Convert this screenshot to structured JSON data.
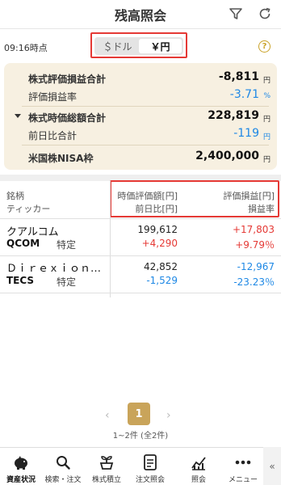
{
  "header": {
    "title": "残高照会"
  },
  "toolbar": {
    "time": "09:16時点"
  },
  "currency_toggle": {
    "dollar_label": "＄ドル",
    "yen_label": "￥円",
    "selected": "yen"
  },
  "summary": {
    "unrealized_total": {
      "label": "株式評価損益合計",
      "value": "-8,811",
      "unit": "円"
    },
    "unrealized_rate": {
      "label": "評価損益率",
      "value": "-3.71",
      "unit": "%"
    },
    "market_value_total": {
      "label": "株式時価総額合計",
      "value": "228,819",
      "unit": "円"
    },
    "day_change_total": {
      "label": "前日比合計",
      "value": "-119",
      "unit": "円"
    },
    "nisa_quota": {
      "label": "米国株NISA枠",
      "value": "2,400,000",
      "unit": "円"
    }
  },
  "table": {
    "header_left": [
      "銘柄",
      "ティッカー"
    ],
    "header_mid": [
      "時価評価額[円]",
      "前日比[円]"
    ],
    "header_right": [
      "評価損益[円]",
      "損益率"
    ],
    "rows": [
      {
        "name": "クアルコム",
        "ticker": "QCOM",
        "account": "特定",
        "market_value": "199,612",
        "day_change": "+4,290",
        "pl": "+17,803",
        "pl_rate": "+9.79％"
      },
      {
        "name": "Ｄｉｒｅｘｉｏｎ…",
        "ticker": "TECS",
        "account": "特定",
        "market_value": "42,852",
        "day_change": "-1,529",
        "pl": "-12,967",
        "pl_rate": "-23.23％"
      }
    ]
  },
  "pagination": {
    "current": "1",
    "count_text": "1~2件 (全2件)"
  },
  "tabbar": {
    "items": [
      {
        "label": "資産状況",
        "icon": "piggy-bank-icon"
      },
      {
        "label": "検索・注文",
        "icon": "search-icon"
      },
      {
        "label": "株式積立",
        "icon": "seedling-icon"
      },
      {
        "label": "注文照会",
        "icon": "order-list-icon"
      },
      {
        "label": "照会",
        "icon": "chart-icon"
      },
      {
        "label": "メニュー",
        "icon": "more-icon"
      }
    ]
  },
  "colors": {
    "accent_gold": "#c9a45a",
    "negative_blue": "#1e88e5",
    "positive_red": "#e53935",
    "summary_bg": "#f7f0e1"
  }
}
